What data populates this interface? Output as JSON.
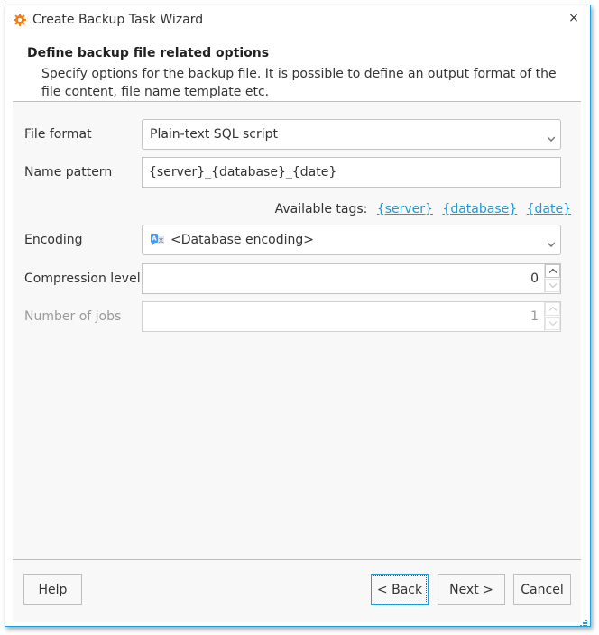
{
  "window": {
    "title": "Create Backup Task Wizard",
    "icon": "gear-icon",
    "close_glyph": "×"
  },
  "header": {
    "title": "Define backup file related options",
    "description": "Specify options for the backup file. It is possible to define an output format of the file content, file name template etc."
  },
  "form": {
    "file_format": {
      "label": "File format",
      "value": "Plain-text SQL script"
    },
    "name_pattern": {
      "label": "Name pattern",
      "value": "{server}_{database}_{date}"
    },
    "available_tags": {
      "label": "Available tags:",
      "tags": [
        "{server}",
        "{database}",
        "{date}"
      ]
    },
    "encoding": {
      "label": "Encoding",
      "value": "<Database encoding>",
      "icon": "language-icon"
    },
    "compression_level": {
      "label": "Compression level",
      "value": "0"
    },
    "number_of_jobs": {
      "label": "Number of jobs",
      "value": "1",
      "disabled": true
    }
  },
  "footer": {
    "help": "Help",
    "back": "< Back",
    "next": "Next >",
    "cancel": "Cancel"
  },
  "colors": {
    "accent": "#1ba1e2",
    "link": "#1a9bd6",
    "icon_orange": "#f07d1a"
  }
}
